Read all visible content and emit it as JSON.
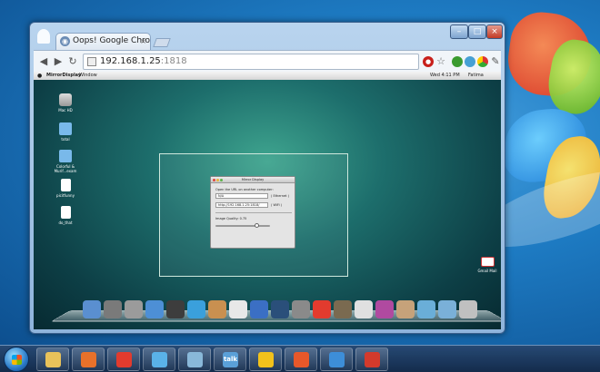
{
  "browser": {
    "tab_title": "Oops! Google Chrome",
    "tab_close": "×",
    "url_host": "192.168.1.25",
    "url_port": ":1818",
    "window_buttons": {
      "minimize": "–",
      "maximize": "□",
      "close": "×"
    }
  },
  "remote_mac": {
    "menubar": {
      "app_name": "MirrorDisplay",
      "menu_window": "Window",
      "clock": "Wed 4:11 PM",
      "user": "Fatima"
    },
    "desktop_icons": [
      "Mac HD",
      "total",
      "Colorful & Murif...exam",
      "picitfunny",
      "do_that"
    ],
    "mail_icon_label": "Gmail Mail",
    "dialog": {
      "title": "Mirror Display",
      "prompt": "Open the URL on another computer:",
      "field1_value": "N/A",
      "field1_tag": "( Ethernet )",
      "field2_value": "http://192.168.1.25:1818/",
      "field2_tag": "( WiFi )",
      "quality_label": "Image Quality: 0.75",
      "quality_value": 0.75
    }
  },
  "colors": {
    "chrome_frame": "#8fb4dc",
    "remote_bg": "#1d6e6c",
    "taskbar": "#1c3556"
  },
  "taskbar_items": [
    {
      "name": "explorer",
      "icon": "folder-icon",
      "color": "#e9c25a"
    },
    {
      "name": "media-player",
      "icon": "play-icon",
      "color": "#e8712a"
    },
    {
      "name": "chrome",
      "icon": "chrome-icon",
      "color": "#e23b2e"
    },
    {
      "name": "paint",
      "icon": "brush-icon",
      "color": "#5ab2e8"
    },
    {
      "name": "notes",
      "icon": "note-icon",
      "color": "#89b8d9"
    },
    {
      "name": "google-talk",
      "icon": "talk-icon",
      "color": "#5aa0d8",
      "label": "talk"
    },
    {
      "name": "snagit",
      "icon": "bird-icon",
      "color": "#f2c21b"
    },
    {
      "name": "firefox",
      "icon": "firefox-icon",
      "color": "#e8582a"
    },
    {
      "name": "remote-desktop",
      "icon": "monitor-icon",
      "color": "#3d8ed8"
    },
    {
      "name": "screenshot-tool",
      "icon": "snip-icon",
      "color": "#d33a2c"
    }
  ]
}
